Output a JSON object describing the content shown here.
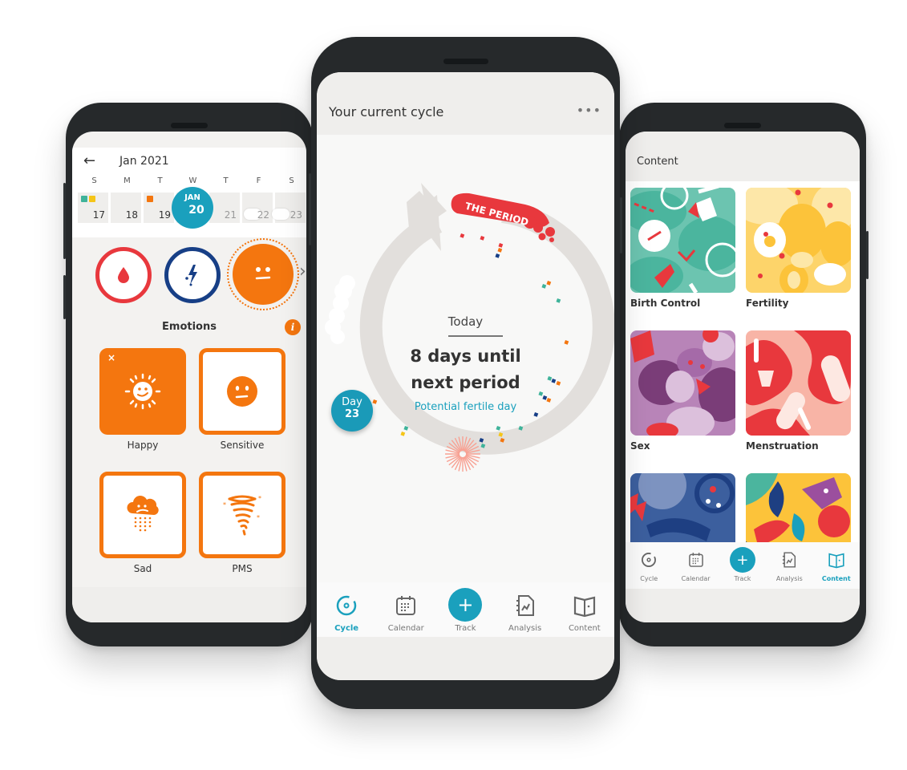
{
  "colors": {
    "accent": "#1aa0bd",
    "period_red": "#e8383d",
    "emotion_orange": "#f4760f",
    "pain_navy": "#173f86",
    "ring_gray": "#e2dfdc",
    "phone_body": "#26292b"
  },
  "left_phone": {
    "calendar": {
      "back_icon": "arrow-left-icon",
      "month_label": "Jan 2021",
      "weekdays": [
        "S",
        "M",
        "T",
        "W",
        "T",
        "F",
        "S"
      ],
      "days": [
        {
          "num": "17",
          "markers": [
            "#3fb39a",
            "#f5c518"
          ]
        },
        {
          "num": "18",
          "markers": []
        },
        {
          "num": "19",
          "markers": [
            "#f4760f"
          ]
        },
        {
          "num": "20",
          "markers": []
        },
        {
          "num": "21",
          "markers": []
        },
        {
          "num": "22",
          "markers": []
        },
        {
          "num": "23",
          "markers": []
        }
      ],
      "today": {
        "month": "JAN",
        "day": "20"
      }
    },
    "categories": [
      {
        "name": "Bleeding",
        "icon": "blood-drop-icon"
      },
      {
        "name": "Pain",
        "icon": "lightning-icon"
      },
      {
        "name": "Emotions",
        "icon": "smiley-icon",
        "selected": true
      }
    ],
    "section_title": "Emotions",
    "info_icon_label": "i",
    "emotions": [
      {
        "label": "Happy",
        "icon": "sun-smiley-icon",
        "selected": true,
        "close": "×"
      },
      {
        "label": "Sensitive",
        "icon": "neutral-face-icon",
        "selected": false
      },
      {
        "label": "Sad",
        "icon": "rain-cloud-icon",
        "selected": false
      },
      {
        "label": "PMS",
        "icon": "tornado-icon",
        "selected": false
      }
    ]
  },
  "middle_phone": {
    "title": "Your current cycle",
    "more_label": "•••",
    "period_label": "THE PERIOD",
    "today_label": "Today",
    "days_until_line1": "8 days until",
    "days_until_line2": "next period",
    "fertile_label": "Potential fertile day",
    "day_badge": {
      "line1": "Day",
      "line2": "23"
    },
    "cycle": {
      "current_day": 23,
      "days_until_next_period": 8
    }
  },
  "tabs": [
    {
      "label": "Cycle",
      "icon": "cycle-icon"
    },
    {
      "label": "Calendar",
      "icon": "calendar-icon"
    },
    {
      "label": "Track",
      "icon": "plus-icon",
      "plus": "+"
    },
    {
      "label": "Analysis",
      "icon": "analysis-icon"
    },
    {
      "label": "Content",
      "icon": "book-icon"
    }
  ],
  "middle_active_tab": "Cycle",
  "right_active_tab": "Content",
  "right_phone": {
    "title": "Content",
    "cards": [
      {
        "label": "Birth Control",
        "colors": [
          "#4bb59e",
          "#e8383d",
          "#ffffff"
        ]
      },
      {
        "label": "Fertility",
        "colors": [
          "#fcc33a",
          "#fde7a8",
          "#e8383d"
        ]
      },
      {
        "label": "Sex",
        "colors": [
          "#a56aa8",
          "#7a3d78",
          "#e8383d"
        ]
      },
      {
        "label": "Menstruation",
        "colors": [
          "#e8383d",
          "#f8b4a6",
          "#ffffff"
        ]
      },
      {
        "label": "",
        "colors": [
          "#3c5f9e",
          "#1e3f82",
          "#e8383d"
        ]
      },
      {
        "label": "",
        "colors": [
          "#fcc33a",
          "#1e3f82",
          "#e8383d"
        ]
      }
    ]
  }
}
